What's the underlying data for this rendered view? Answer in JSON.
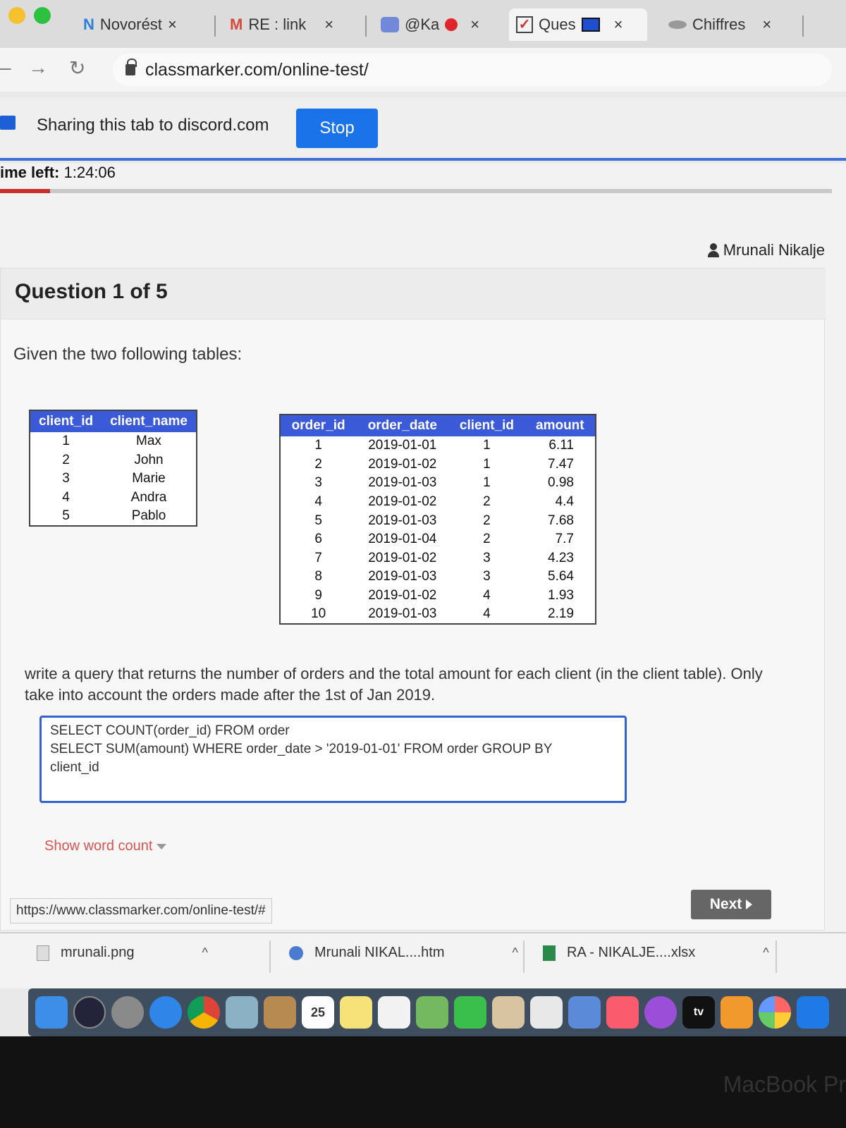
{
  "browser": {
    "tabs": [
      {
        "icon_text": "N",
        "icon_color": "#2d7fd8",
        "label": "Novorést"
      },
      {
        "icon_text": "M",
        "icon_color": "#d64a3b",
        "label": "RE : link"
      },
      {
        "icon_text": "",
        "icon_color": "#7289da",
        "label": "@Ka"
      },
      {
        "icon_text": "✓",
        "icon_color": "#d32f2f",
        "label": "Ques"
      },
      {
        "icon_text": "",
        "icon_color": "#888888",
        "label": "Chiffres"
      }
    ],
    "close_glyph": "×",
    "url": "classmarker.com/online-test/"
  },
  "sharing": {
    "text": "Sharing this tab to discord.com",
    "stop_label": "Stop"
  },
  "quiz": {
    "time_label": "ime left:",
    "time_value": "1:24:06",
    "progress": 0.06,
    "user": "Mrunali Nikalje",
    "question_title": "Question 1 of 5",
    "intro": "Given the two following tables:",
    "clients_table": {
      "headers": [
        "client_id",
        "client_name"
      ],
      "rows": [
        [
          "1",
          "Max"
        ],
        [
          "2",
          "John"
        ],
        [
          "3",
          "Marie"
        ],
        [
          "4",
          "Andra"
        ],
        [
          "5",
          "Pablo"
        ]
      ]
    },
    "orders_table": {
      "headers": [
        "order_id",
        "order_date",
        "client_id",
        "amount"
      ],
      "rows": [
        [
          "1",
          "2019-01-01",
          "1",
          "6.11"
        ],
        [
          "2",
          "2019-01-02",
          "1",
          "7.47"
        ],
        [
          "3",
          "2019-01-03",
          "1",
          "0.98"
        ],
        [
          "4",
          "2019-01-02",
          "2",
          "4.4"
        ],
        [
          "5",
          "2019-01-03",
          "2",
          "7.68"
        ],
        [
          "6",
          "2019-01-04",
          "2",
          "7.7"
        ],
        [
          "7",
          "2019-01-02",
          "3",
          "4.23"
        ],
        [
          "8",
          "2019-01-03",
          "3",
          "5.64"
        ],
        [
          "9",
          "2019-01-02",
          "4",
          "1.93"
        ],
        [
          "10",
          "2019-01-03",
          "4",
          "2.19"
        ]
      ]
    },
    "question_text": "write a query that returns the number of orders and the total amount for each client (in the client table). Only take into account the orders made after the 1st of Jan 2019.",
    "answer": "SELECT COUNT(order_id) FROM order\nSELECT SUM(amount) WHERE order_date > '2019-01-01' FROM order GROUP BY\nclient_id",
    "word_count_label": "Show word count",
    "next_label": "Next",
    "status_url": "https://www.classmarker.com/online-test/#"
  },
  "downloads": [
    {
      "name": "mrunali.png"
    },
    {
      "name": "Mrunali NIKAL....htm"
    },
    {
      "name": "RA - NIKALJE....xlsx"
    }
  ],
  "dock": {
    "calendar_day": "25",
    "tv_label": "tv"
  },
  "device_brand": "MacBook Pr"
}
